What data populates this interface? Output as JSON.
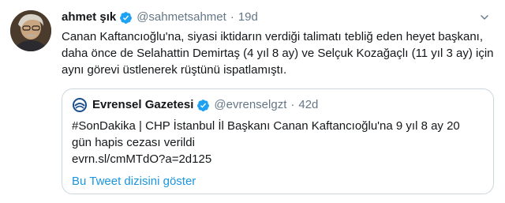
{
  "tweet": {
    "name": "ahmet şık",
    "handle": "@sahmetsahmet",
    "separator": "·",
    "time": "19d",
    "text": "Canan Kaftancıoğlu'na, siyasi iktidarın verdiği talimatı tebliğ eden heyet başkanı, daha önce de Selahattin Demirtaş (4 yıl 8 ay) ve Selçuk Kozağaçlı (11 yıl 3 ay) için aynı görevi üstlenerek rüştünü ispatlamıştı."
  },
  "quoted": {
    "name": "Evrensel Gazetesi",
    "handle": "@evrenselgzt",
    "separator": "·",
    "time": "42d",
    "text_line1": "#SonDakika | CHP İstanbul İl Başkanı Canan Kaftancıoğlu'na 9 yıl 8 ay 20",
    "text_line2": "gün hapis cezası verildi",
    "text_line3": "evrn.sl/cmMTdO?a=2d125",
    "thread_link": "Bu Tweet dizisini göster"
  },
  "icons": {
    "verified": "verified-badge-icon",
    "caret": "chevron-down-icon",
    "avatar": "user-avatar",
    "quoted_avatar": "evrensel-logo"
  },
  "colors": {
    "verified": "#1da1f2",
    "link": "#1b95e0",
    "secondary_text": "#657786",
    "border": "#ccd6dd"
  }
}
